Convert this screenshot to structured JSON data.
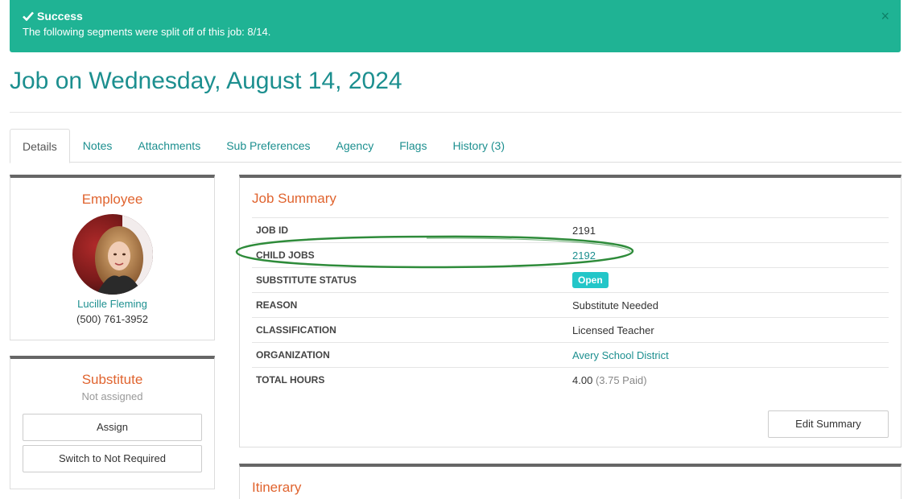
{
  "alert": {
    "title": "Success",
    "message": "The following segments were split off of this job: 8/14.",
    "close": "×",
    "color": "#1fb394"
  },
  "page": {
    "title": "Job on Wednesday, August 14, 2024"
  },
  "tabs": [
    {
      "label": "Details",
      "active": true
    },
    {
      "label": "Notes",
      "active": false
    },
    {
      "label": "Attachments",
      "active": false
    },
    {
      "label": "Sub Preferences",
      "active": false
    },
    {
      "label": "Agency",
      "active": false
    },
    {
      "label": "Flags",
      "active": false
    },
    {
      "label": "History (3)",
      "active": false
    }
  ],
  "employee": {
    "heading": "Employee",
    "name": "Lucille Fleming",
    "phone": "(500) 761-3952"
  },
  "substitute": {
    "heading": "Substitute",
    "status": "Not assigned",
    "assign_label": "Assign",
    "switch_label": "Switch to Not Required"
  },
  "summary": {
    "heading": "Job Summary",
    "rows": {
      "job_id": {
        "label": "JOB ID",
        "value": "2191"
      },
      "child_jobs": {
        "label": "CHILD JOBS",
        "value": "2192"
      },
      "status": {
        "label": "SUBSTITUTE STATUS",
        "value": "Open"
      },
      "reason": {
        "label": "REASON",
        "value": "Substitute Needed"
      },
      "classification": {
        "label": "CLASSIFICATION",
        "value": "Licensed Teacher"
      },
      "organization": {
        "label": "ORGANIZATION",
        "value": "Avery School District"
      },
      "hours": {
        "label": "TOTAL HOURS",
        "value": "4.00",
        "paid": "(3.75 Paid)"
      }
    },
    "edit_label": "Edit Summary"
  },
  "itinerary": {
    "heading": "Itinerary"
  },
  "colors": {
    "accent": "#1c8f8f",
    "heading": "#e0642f",
    "badge": "#23c6c8",
    "highlight": "#2e8b3a"
  }
}
